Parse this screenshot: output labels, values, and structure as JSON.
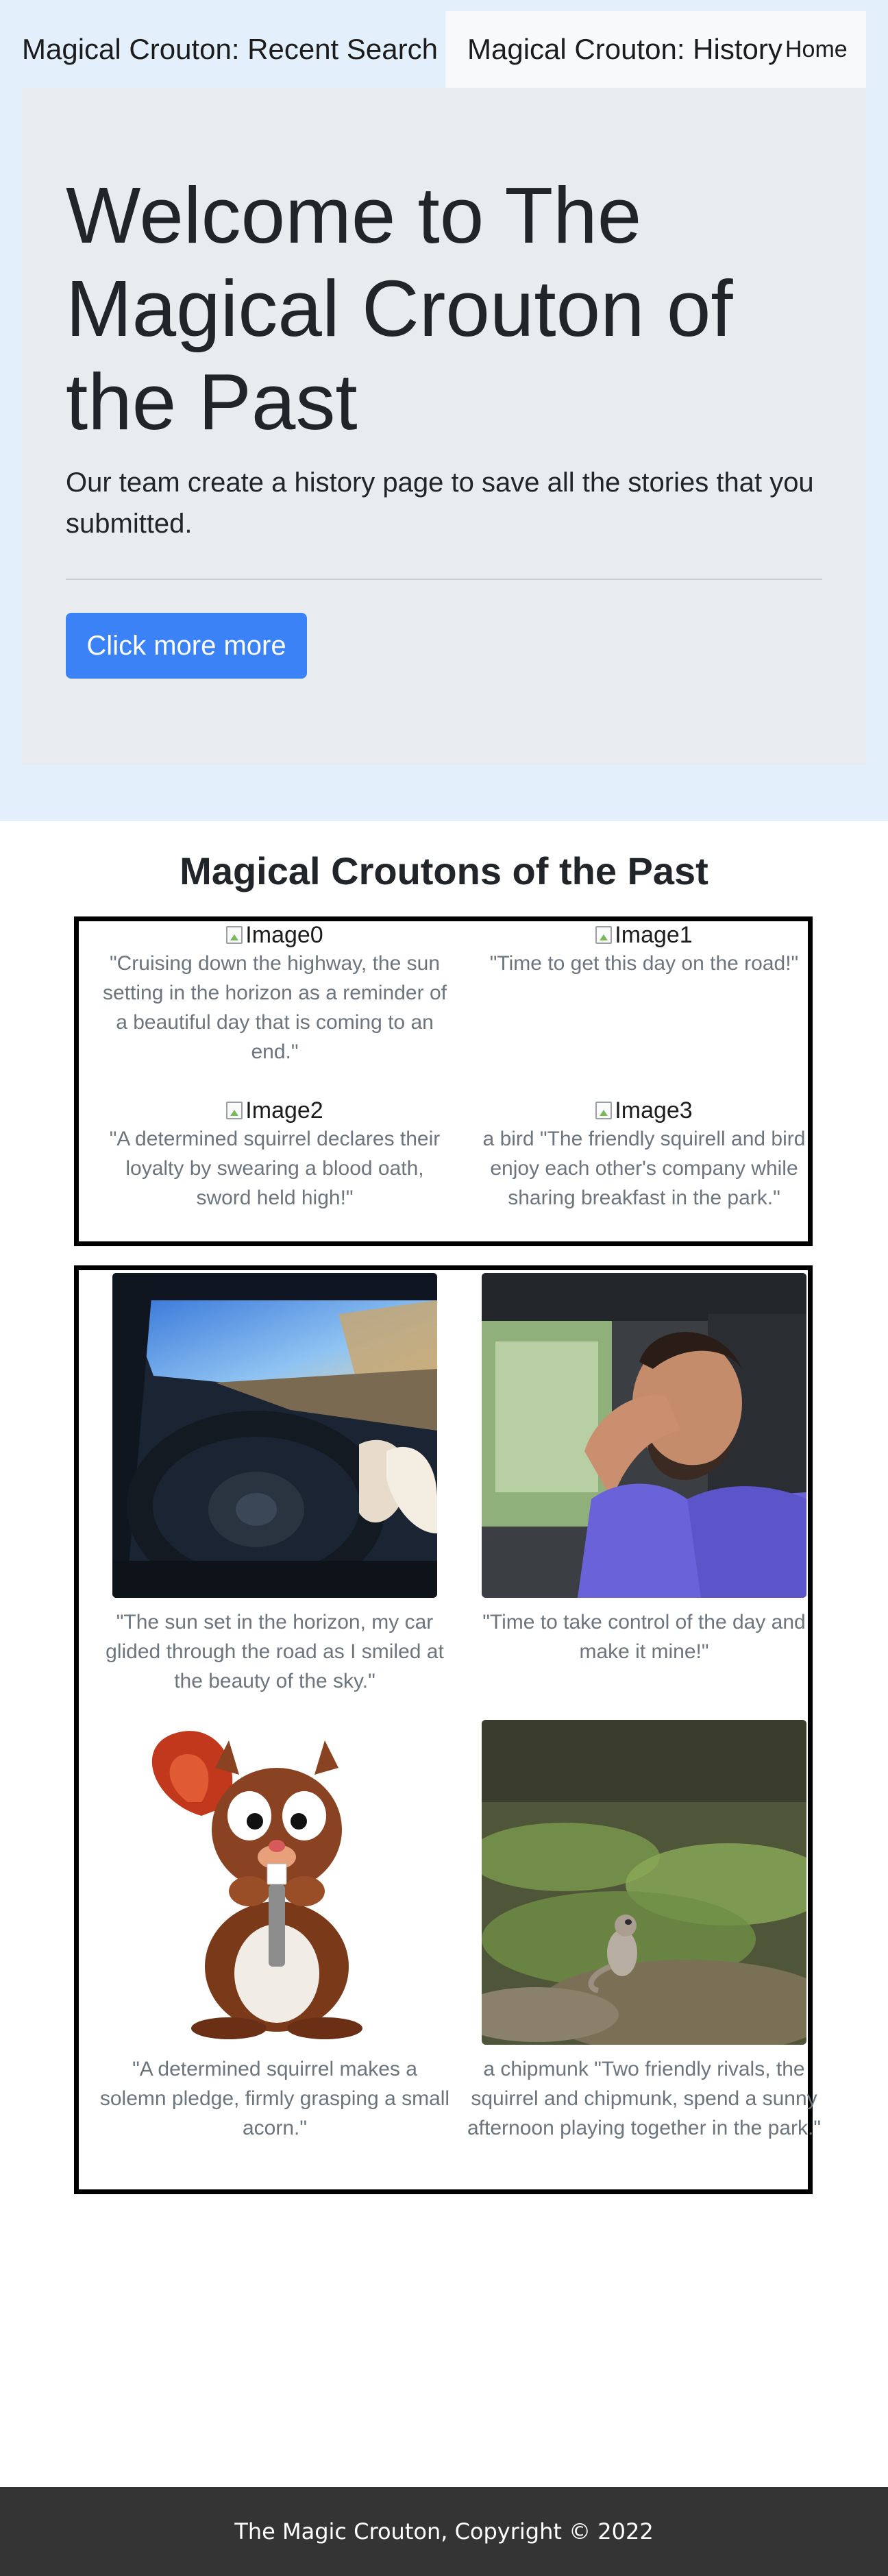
{
  "navbar": {
    "brand": "Magical Crouton: Recent Search",
    "history": "Magical Crouton: History",
    "home": "Home"
  },
  "jumbotron": {
    "title": "Welcome to The Magical Crouton of the Past",
    "lead": "Our team create a history page to save all the stories that you submitted.",
    "button_label": "Click more more"
  },
  "gallery_title": "Magical Croutons of the Past",
  "broken_items": [
    {
      "alt": "Image0",
      "caption": "\"Cruising down the highway, the sun setting in the horizon as a reminder of a beautiful day that is coming to an end.\""
    },
    {
      "alt": "Image1",
      "caption": "\"Time to get this day on the road!\""
    },
    {
      "alt": "Image2",
      "caption": "\"A determined squirrel declares their loyalty by swearing a blood oath, sword held high!\""
    },
    {
      "alt": "Image3",
      "caption": "a bird \"The friendly squirell and bird enjoy each other's company while sharing breakfast in the park.\""
    }
  ],
  "photo_items": [
    {
      "caption": "\"The sun set in the horizon, my car glided through the road as I smiled at the beauty of the sky.\""
    },
    {
      "caption": "\"Time to take control of the day and make it mine!\""
    },
    {
      "caption": "\"A determined squirrel makes a solemn pledge, firmly grasping a small acorn.\""
    },
    {
      "caption": "a chipmunk \"Two friendly rivals, the squirrel and chipmunk, spend a sunny afternoon playing together in the park.\""
    }
  ],
  "footer": {
    "text": "The Magic Crouton, Copyright © 2022"
  },
  "colors": {
    "banner_bg": "#e3f0fb",
    "jumbotron_bg": "#e9ecef",
    "primary_button": "#3b82f6",
    "caption_text": "#6c757d",
    "footer_bg": "#343434"
  }
}
